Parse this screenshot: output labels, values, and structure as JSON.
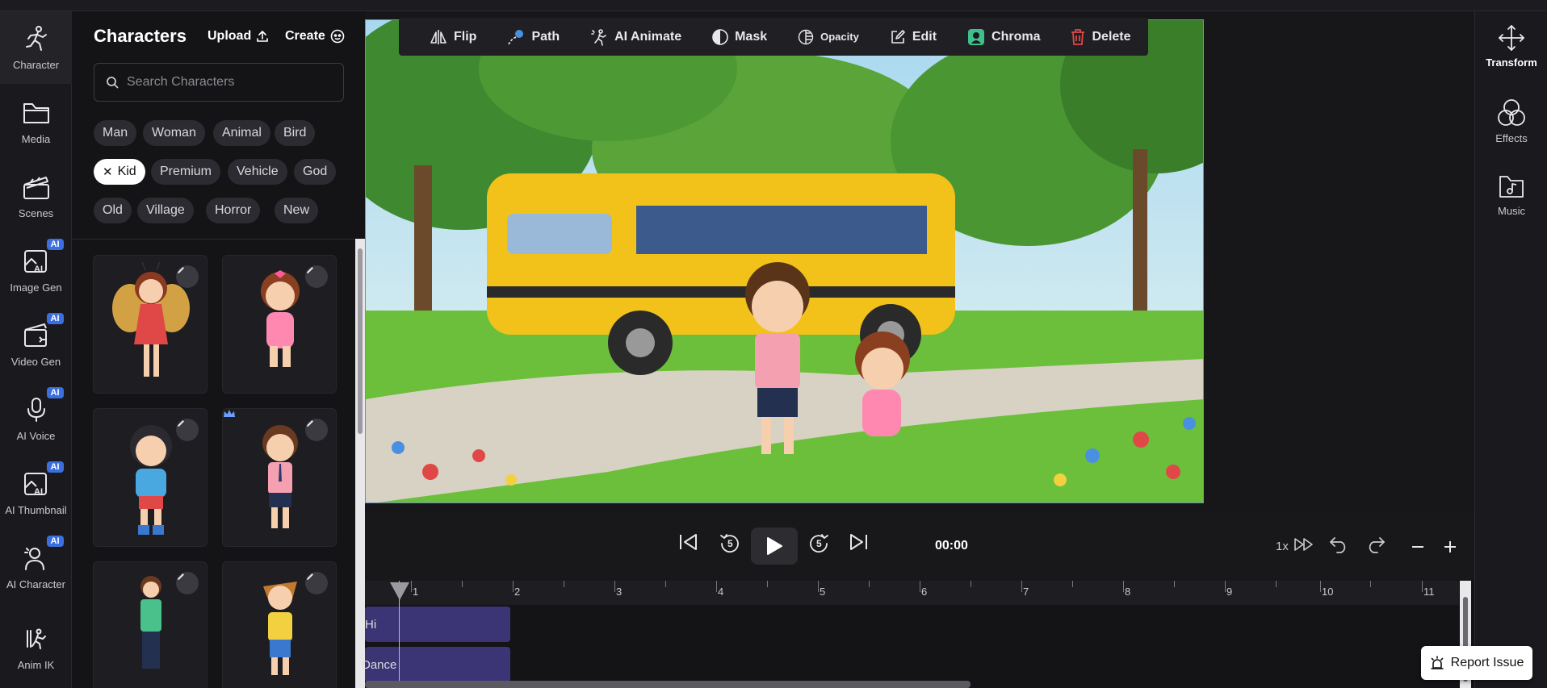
{
  "left_rail": {
    "items": [
      {
        "label": "Character",
        "icon": "running-figure-icon"
      },
      {
        "label": "Media",
        "icon": "folder-icon"
      },
      {
        "label": "Scenes",
        "icon": "clapperboard-icon"
      },
      {
        "label": "Image Gen",
        "icon": "ai-image-icon",
        "badge": "AI"
      },
      {
        "label": "Video Gen",
        "icon": "ai-video-icon",
        "badge": "AI"
      },
      {
        "label": "AI Voice",
        "icon": "microphone-icon",
        "badge": "AI"
      },
      {
        "label": "AI Thumbnail",
        "icon": "ai-thumbnail-icon",
        "badge": "AI"
      },
      {
        "label": "AI Character",
        "icon": "ai-character-icon",
        "badge": "AI"
      },
      {
        "label": "Anim IK",
        "icon": "anim-ik-icon"
      }
    ]
  },
  "panel": {
    "title": "Characters",
    "upload_label": "Upload",
    "create_label": "Create",
    "search_placeholder": "Search Characters",
    "chips": [
      "Man",
      "Woman",
      "Animal",
      "Bird",
      "Kid",
      "Premium",
      "Vehicle",
      "God",
      "Old",
      "Village",
      "Horror",
      "New"
    ],
    "active_chip": "Kid"
  },
  "toolbar": {
    "flip": "Flip",
    "path": "Path",
    "ai_animate": "AI Animate",
    "mask": "Mask",
    "opacity": "Opacity",
    "edit": "Edit",
    "chroma": "Chroma",
    "delete": "Delete"
  },
  "right_rail": {
    "transform": "Transform",
    "effects": "Effects",
    "music": "Music"
  },
  "playback": {
    "time": "00:00",
    "speed": "1x",
    "rewind_seconds": "5",
    "forward_seconds": "5"
  },
  "timeline": {
    "ticks": [
      "1",
      "2",
      "3",
      "4",
      "5",
      "6",
      "7",
      "8",
      "9",
      "10",
      "11"
    ],
    "clips": [
      "Hi",
      "Dance"
    ]
  },
  "report_label": "Report Issue",
  "colors": {
    "accent": "#3b6fe0",
    "clip": "#3b3576",
    "delete": "#e04848",
    "chroma": "#3fbf8a"
  }
}
